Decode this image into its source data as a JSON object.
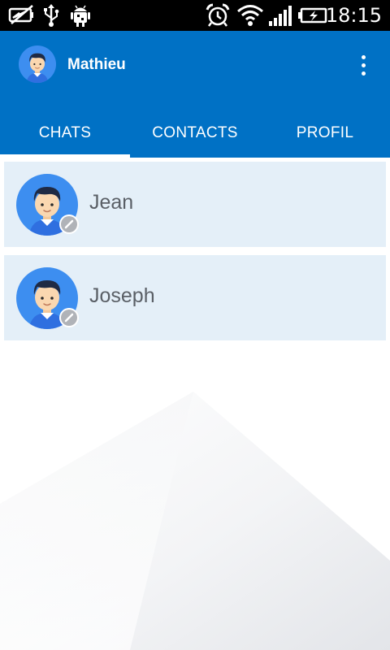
{
  "status_bar": {
    "time": "18:15",
    "icons": [
      "no-battery-saver-icon",
      "usb-icon",
      "android-debug-icon",
      "alarm-icon",
      "wifi-icon",
      "signal-icon",
      "battery-charging-icon"
    ]
  },
  "header": {
    "user_name": "Mathieu",
    "avatar_icon": "user-avatar-icon",
    "menu_icon": "overflow-menu-icon",
    "background_color": "#0071c5"
  },
  "tabs": [
    {
      "label": "CHATS",
      "active": true
    },
    {
      "label": "CONTACTS",
      "active": false
    },
    {
      "label": "PROFIL",
      "active": false
    }
  ],
  "chats": [
    {
      "name": "Jean",
      "status": "offline"
    },
    {
      "name": "Joseph",
      "status": "offline"
    }
  ],
  "colors": {
    "accent": "#0071c5",
    "row_background": "#e4eff8",
    "avatar_circle": "#3d8ef0",
    "status_dot": "#b0b3b8"
  }
}
